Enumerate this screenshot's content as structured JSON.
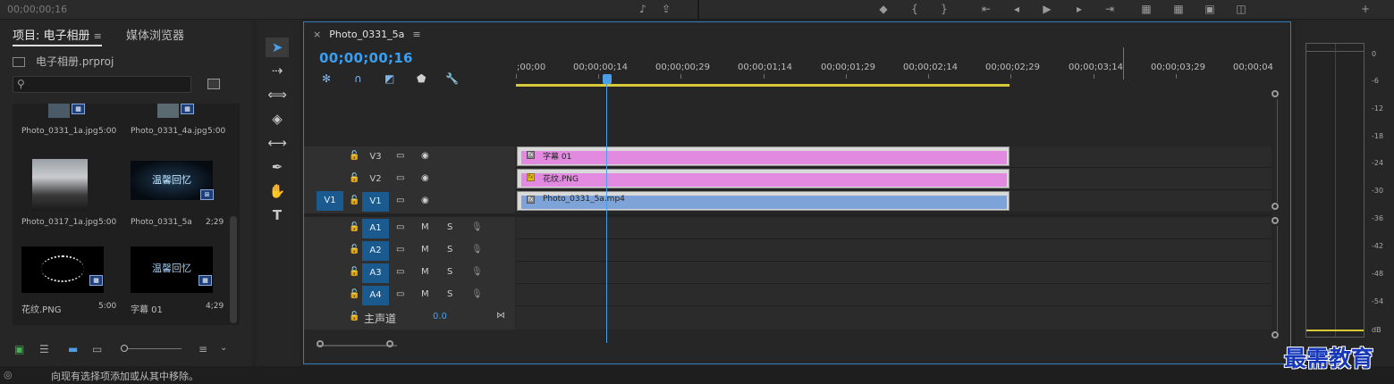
{
  "top": {
    "timecode": "00;00;00;16"
  },
  "project": {
    "tabs": {
      "project": "项目: 电子相册",
      "project_menu": "≡",
      "media_browser": "媒体浏览器"
    },
    "file_name": "电子相册.prproj",
    "items": [
      {
        "name": "Photo_0331_1a.jpg",
        "duration": "5:00"
      },
      {
        "name": "Photo_0331_4a.jpg",
        "duration": "5:00"
      },
      {
        "name": "Photo_0317_1a.jpg",
        "duration": "5:00"
      },
      {
        "name": "Photo_0331_5a",
        "duration": "2;29",
        "thumb_text": "温馨回忆"
      },
      {
        "name": "花纹.PNG",
        "duration": "5:00"
      },
      {
        "name": "字幕 01",
        "duration": "4;29",
        "thumb_text": "温馨回忆"
      }
    ]
  },
  "timeline": {
    "tab_close": "×",
    "tab_name": "Photo_0331_5a",
    "tab_menu": "≡",
    "timecode": "00;00;00;16",
    "ruler": [
      ";00;00",
      "00;00;00;14",
      "00;00;00;29",
      "00;00;01;14",
      "00;00;01;29",
      "00;00;02;14",
      "00;00;02;29",
      "00;00;03;14",
      "00;00;03;29",
      "00;00;04"
    ],
    "video_tracks": [
      "V3",
      "V2",
      "V1"
    ],
    "source_patch": "V1",
    "audio_tracks": [
      "A1",
      "A2",
      "A3",
      "A4"
    ],
    "mute": "M",
    "solo": "S",
    "master": {
      "label": "主声道",
      "value": "0.0"
    },
    "clips": [
      {
        "name": "字幕 01",
        "fx": "fx",
        "color": "#e28ae0"
      },
      {
        "name": "花纹.PNG",
        "fx": "fx",
        "color": "#e28ae0"
      },
      {
        "name": "Photo_0331_5a.mp4",
        "fx": "fx",
        "color": "#7ea3d8"
      }
    ]
  },
  "meter": {
    "labels": [
      "0",
      "-6",
      "-12",
      "-18",
      "-24",
      "-30",
      "-36",
      "-42",
      "-48",
      "-54",
      "dB"
    ]
  },
  "status": {
    "text": "向现有选择项添加或从其中移除。"
  },
  "watermark": "最需教育"
}
